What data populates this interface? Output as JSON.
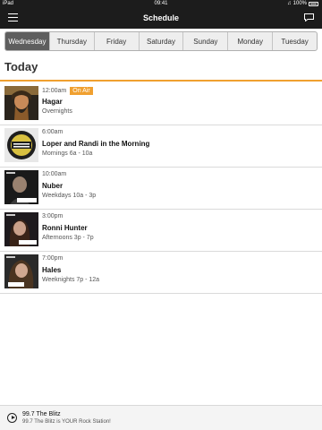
{
  "status_bar": {
    "device": "iPad",
    "time": "09:41",
    "battery": "100%"
  },
  "nav": {
    "title": "Schedule",
    "menu_icon": "hamburger-menu-icon",
    "chat_icon": "chat-bubble-icon"
  },
  "tabs": [
    {
      "label": "Wednesday",
      "active": true
    },
    {
      "label": "Thursday",
      "active": false
    },
    {
      "label": "Friday",
      "active": false
    },
    {
      "label": "Saturday",
      "active": false
    },
    {
      "label": "Sunday",
      "active": false
    },
    {
      "label": "Monday",
      "active": false
    },
    {
      "label": "Tuesday",
      "active": false
    }
  ],
  "section_title": "Today",
  "accent_color": "#f0a030",
  "shows": [
    {
      "time": "12:00am",
      "badge": "On Air",
      "name": "Hagar",
      "slot": "Overnights"
    },
    {
      "time": "6:00am",
      "name": "Loper and Randi in the Morning",
      "slot": "Mornings 6a - 10a"
    },
    {
      "time": "10:00am",
      "name": "Nuber",
      "slot": "Weekdays 10a - 3p"
    },
    {
      "time": "3:00pm",
      "name": "Ronni Hunter",
      "slot": "Afternoons 3p - 7p"
    },
    {
      "time": "7:00pm",
      "name": "Hales",
      "slot": "Weeknights 7p - 12a"
    }
  ],
  "player": {
    "station": "99.7 The Blitz",
    "tagline": "99.7 The Blitz is YOUR Rock Station!"
  }
}
